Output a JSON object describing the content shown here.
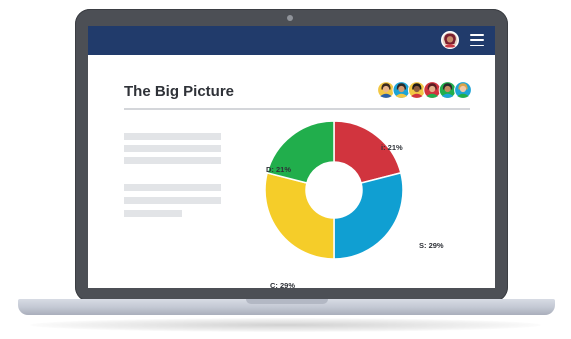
{
  "page": {
    "title": "The Big Picture"
  },
  "appbar": {
    "menu_icon": "hamburger-menu-icon",
    "user_avatar_icon": "user-avatar-icon",
    "color": "#213b6b"
  },
  "team": {
    "avatar_icon": "team-member-avatar-icon",
    "avatar_count": 6
  },
  "chart_data": {
    "type": "pie",
    "style": "donut",
    "categories": [
      "i",
      "S",
      "C",
      "D"
    ],
    "values": [
      21,
      29,
      29,
      21
    ],
    "unit": "%",
    "labels": [
      "i: 21%",
      "S: 29%",
      "C: 29%",
      "D: 21%"
    ],
    "colors": [
      "#d1343e",
      "#109fd2",
      "#f5cd29",
      "#21ae4c"
    ],
    "title": "",
    "legend": "none"
  }
}
